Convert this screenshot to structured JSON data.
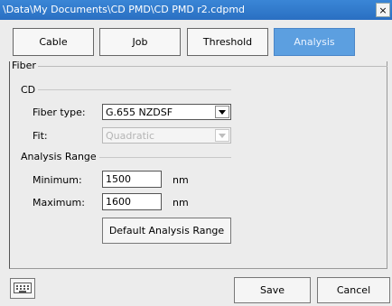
{
  "window": {
    "title": "\\Data\\My Documents\\CD PMD\\CD PMD r2.cdpmd",
    "close_glyph": "×"
  },
  "tabs": [
    {
      "label": "Cable",
      "active": false
    },
    {
      "label": "Job",
      "active": false
    },
    {
      "label": "Threshold",
      "active": false
    },
    {
      "label": "Analysis",
      "active": true
    }
  ],
  "fiber_group": {
    "legend": "Fiber",
    "cd_label": "CD",
    "fiber_type_label": "Fiber type:",
    "fiber_type_value": "G.655 NZDSF",
    "fit_label": "Fit:",
    "fit_value": "Quadratic",
    "fit_enabled": false
  },
  "analysis_range": {
    "label": "Analysis Range",
    "minimum_label": "Minimum:",
    "minimum_value": "1500",
    "maximum_label": "Maximum:",
    "maximum_value": "1600",
    "unit": "nm",
    "default_button": "Default Analysis Range"
  },
  "footer": {
    "keyboard_icon": "keyboard-icon",
    "save_label": "Save",
    "cancel_label": "Cancel"
  },
  "colors": {
    "titlebar": "#2f78cc",
    "active_tab": "#5c9fe0"
  }
}
